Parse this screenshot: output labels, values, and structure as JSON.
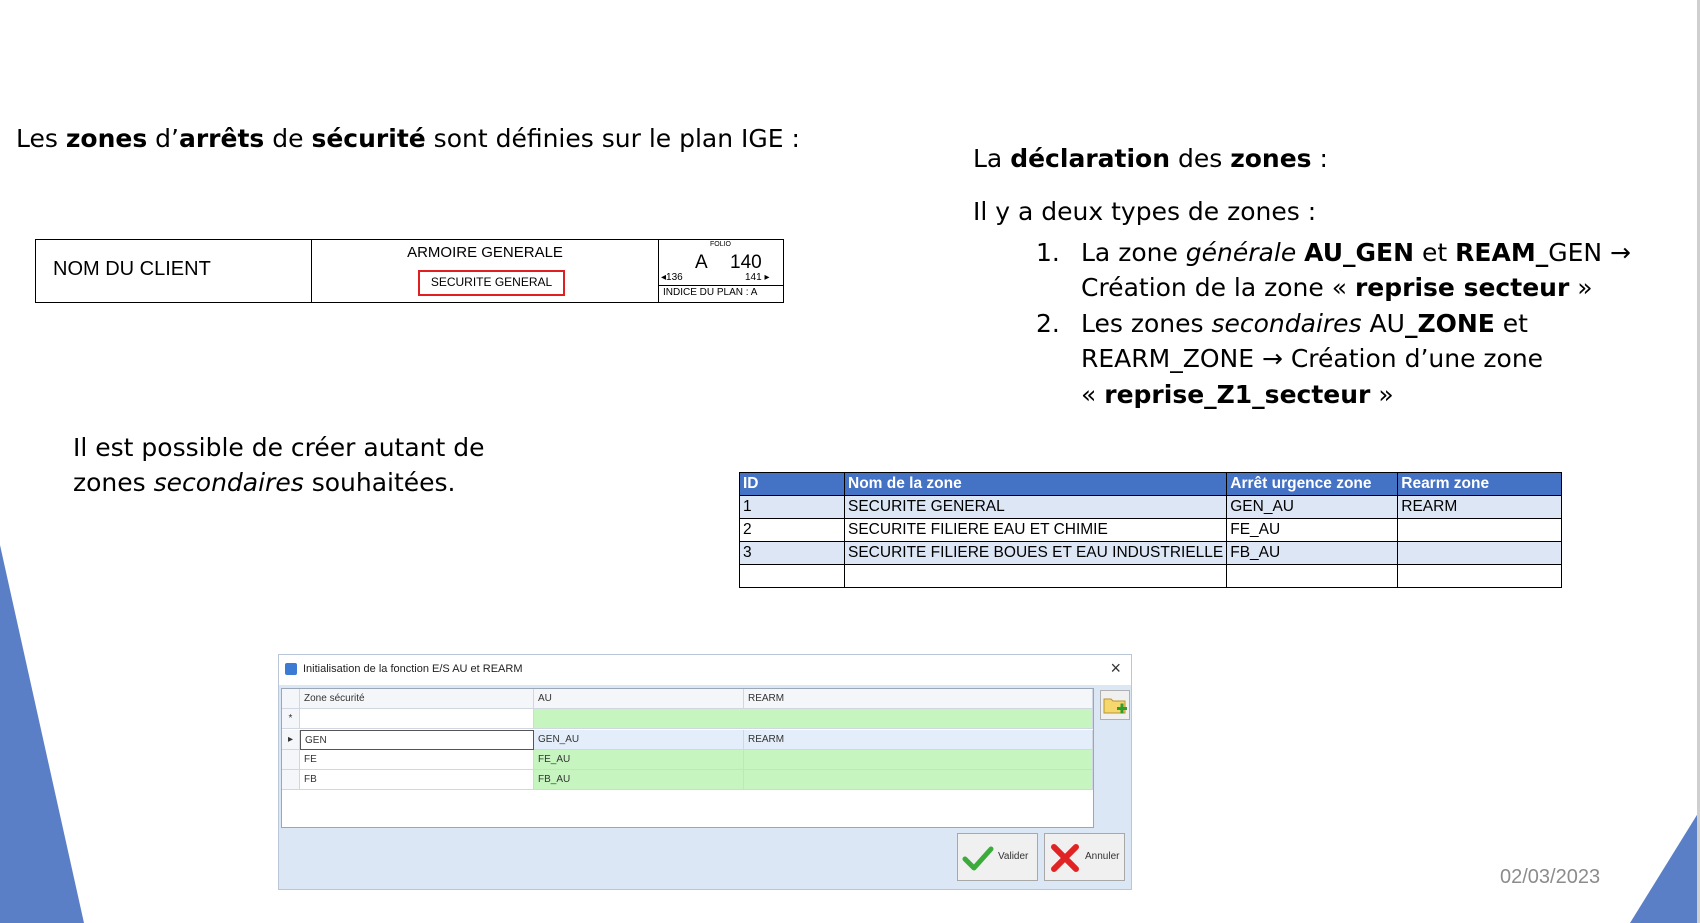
{
  "left_heading": {
    "parts": [
      {
        "text": "Les ",
        "bold": false
      },
      {
        "text": "zones",
        "bold": true
      },
      {
        "text": " d’",
        "bold": false
      },
      {
        "text": "arrêts",
        "bold": true
      },
      {
        "text": " de ",
        "bold": false
      },
      {
        "text": "sécurité",
        "bold": true
      },
      {
        "text": " sont définies sur le plan IGE :",
        "bold": false
      }
    ]
  },
  "title_block": {
    "client": "NOM DU CLIENT",
    "armoire": "ARMOIRE GENERALE",
    "securite": "SECURITE GENERAL",
    "folio_label": "FOLIO",
    "folio_letter": "A",
    "folio_number": "140",
    "prev_folio": "136",
    "next_folio": "141",
    "indice": "INDICE DU PLAN : A"
  },
  "note": {
    "line1": "Il est possible de créer autant de",
    "line2_a": "zones ",
    "line2_b": "secondaires",
    "line2_c": " souhaitées."
  },
  "right_heading": {
    "a": "La ",
    "b": "déclaration",
    "c": " des ",
    "d": "zones",
    "e": " :"
  },
  "types_intro": "Il y a deux types de zones :",
  "list": {
    "item1": {
      "num": "1.",
      "l1_a": "La zone ",
      "l1_b": "générale",
      "l1_c": " ",
      "l1_d": "AU_GEN",
      "l1_e": " et ",
      "l1_f": "REAM_",
      "l1_g": "GEN →",
      "l2_a": "Création de la zone « ",
      "l2_b": "reprise secteur",
      "l2_c": " »"
    },
    "item2": {
      "num": "2.",
      "l1_a": "Les zones ",
      "l1_b": "secondaires",
      "l1_c": " AU",
      "l1_d": "_ZONE",
      "l1_e": " et",
      "l2": "REARM_ZONE → Création d’une zone",
      "l3_a": "« ",
      "l3_b": "reprise_Z1_secteur",
      "l3_c": " »"
    }
  },
  "zone_table": {
    "headers": [
      "ID",
      "Nom de la zone",
      "Arrêt urgence zone",
      "Rearm zone"
    ],
    "rows": [
      [
        "1",
        "SECURITE GENERAL",
        "GEN_AU",
        "REARM"
      ],
      [
        "2",
        "SECURITE FILIERE EAU ET CHIMIE",
        "FE_AU",
        ""
      ],
      [
        "3",
        "SECURITE FILIERE BOUES ET EAU INDUSTRIELLE",
        "FB_AU",
        ""
      ],
      [
        "",
        "",
        "",
        ""
      ]
    ]
  },
  "dialog": {
    "title": "Initialisation de la fonction E/S AU et REARM",
    "close": "×",
    "columns": [
      "Zone sécurité",
      "AU",
      "REARM"
    ],
    "new_row_marker": "*",
    "rows": [
      {
        "marker": "▸",
        "zone": "GEN",
        "au": "GEN_AU",
        "rearm": "REARM"
      },
      {
        "marker": "",
        "zone": "FE",
        "au": "FE_AU",
        "rearm": ""
      },
      {
        "marker": "",
        "zone": "FB",
        "au": "FB_AU",
        "rearm": ""
      }
    ],
    "validate_label": "Valider",
    "cancel_label": "Annuler"
  },
  "date": "02/03/2023",
  "colors": {
    "accent_blue": "#4472c4",
    "triangle_blue": "#5b7fc6",
    "table_row": "#dde6f5",
    "dialog_bg": "#dbe7f5",
    "green_cell": "#c6f5c0",
    "highlight_red": "#e02020"
  }
}
